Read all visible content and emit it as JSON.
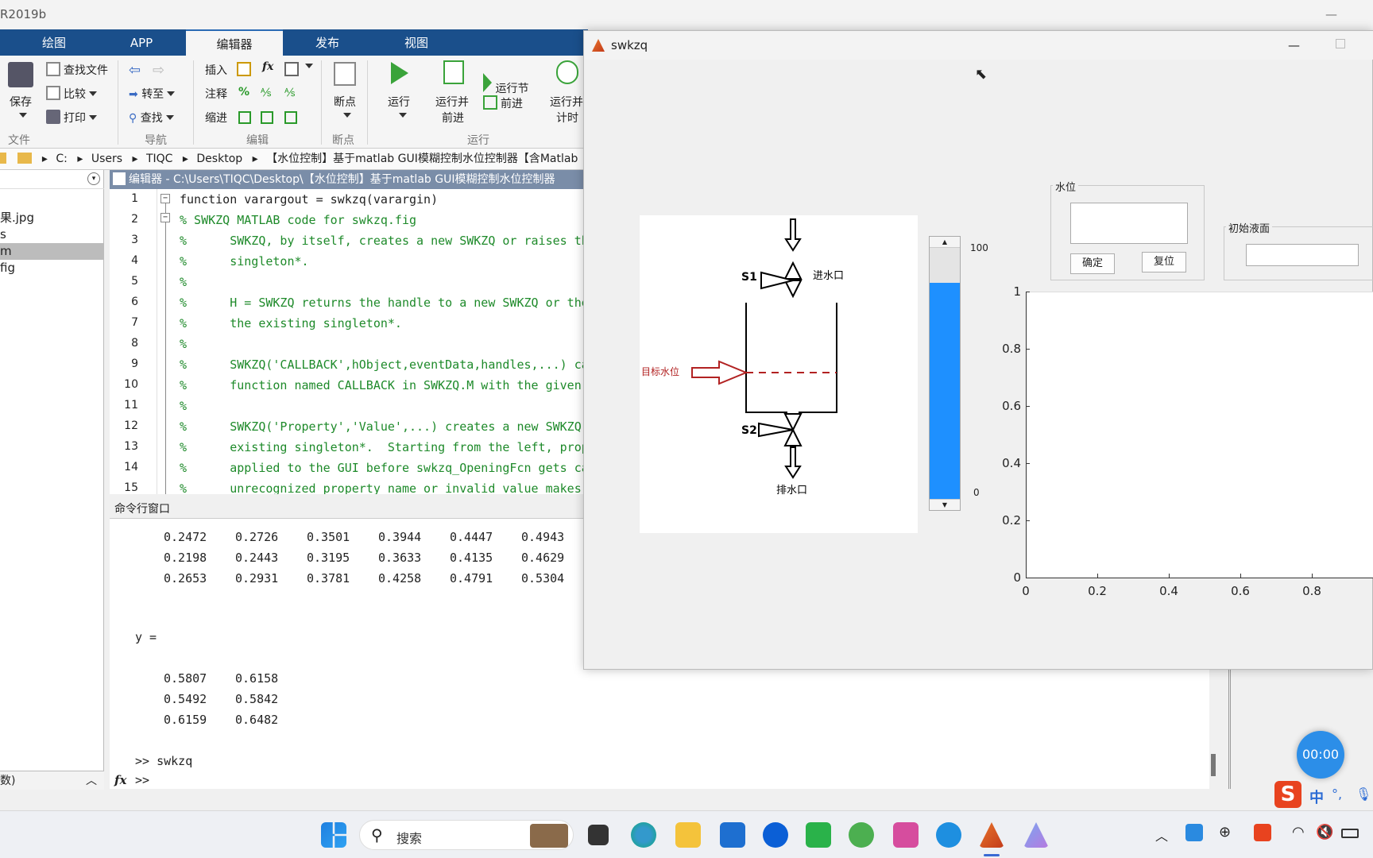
{
  "app": {
    "window_title": "R2019b",
    "tabs": [
      "绘图",
      "APP",
      "编辑器",
      "发布",
      "视图"
    ],
    "active_tab": "编辑器"
  },
  "toolstrip": {
    "file": {
      "save": "保存",
      "find_files": "查找文件",
      "compare": "比较",
      "print": "打印",
      "section": "文件"
    },
    "navigate": {
      "goto": "转至",
      "find": "查找",
      "section": "导航"
    },
    "edit": {
      "insert": "插入",
      "fx": "fx",
      "comment": "注释",
      "comment_sym": "%",
      "indent": "缩进",
      "section": "编辑"
    },
    "breakpoints": {
      "label": "断点",
      "section": "断点"
    },
    "run": {
      "run": "运行",
      "run_advance_1": "运行并",
      "run_advance_2": "前进",
      "run_section": "运行节",
      "advance": "前进",
      "run_time_1": "运行并",
      "run_time_2": "计时",
      "section": "运行"
    }
  },
  "address": {
    "crumbs": [
      "C:",
      "Users",
      "TIQC",
      "Desktop",
      "【水位控制】基于matlab GUI模糊控制水位控制器【含Matlab"
    ]
  },
  "file_browser": {
    "items": [
      "果.jpg",
      "s",
      "m",
      "fig"
    ],
    "selected_index": 2
  },
  "editor": {
    "header": "编辑器 - C:\\Users\\TIQC\\Desktop\\【水位控制】基于matlab GUI模糊控制水位控制器",
    "lines": [
      {
        "n": "1",
        "text": "function varargout = swkzq(varargin)"
      },
      {
        "n": "2",
        "text": "% SWKZQ MATLAB code for swkzq.fig"
      },
      {
        "n": "3",
        "text": "%      SWKZQ, by itself, creates a new SWKZQ or raises th"
      },
      {
        "n": "4",
        "text": "%      singleton*."
      },
      {
        "n": "5",
        "text": "%"
      },
      {
        "n": "6",
        "text": "%      H = SWKZQ returns the handle to a new SWKZQ or the"
      },
      {
        "n": "7",
        "text": "%      the existing singleton*."
      },
      {
        "n": "8",
        "text": "%"
      },
      {
        "n": "9",
        "text": "%      SWKZQ('CALLBACK',hObject,eventData,handles,...) ca"
      },
      {
        "n": "10",
        "text": "%      function named CALLBACK in SWKZQ.M with the given"
      },
      {
        "n": "11",
        "text": "%"
      },
      {
        "n": "12",
        "text": "%      SWKZQ('Property','Value',...) creates a new SWKZQ"
      },
      {
        "n": "13",
        "text": "%      existing singleton*.  Starting from the left, prop"
      },
      {
        "n": "14",
        "text": "%      applied to the GUI before swkzq_OpeningFcn gets ca"
      },
      {
        "n": "15",
        "text": "%      unrecognized property name or invalid value makes"
      }
    ]
  },
  "command_window": {
    "title": "命令行窗口",
    "matrix_rows": [
      [
        "0.2472",
        "0.2726",
        "0.3501",
        "0.3944",
        "0.4447",
        "0.4943"
      ],
      [
        "0.2198",
        "0.2443",
        "0.3195",
        "0.3633",
        "0.4135",
        "0.4629"
      ],
      [
        "0.2653",
        "0.2931",
        "0.3781",
        "0.4258",
        "0.4791",
        "0.5304"
      ]
    ],
    "var_label": "y =",
    "y_rows": [
      [
        "0.5807",
        "0.6158"
      ],
      [
        "0.5492",
        "0.5842"
      ],
      [
        "0.6159",
        "0.6482"
      ]
    ],
    "last_command": ">> swkzq",
    "prompt_fx": "fx",
    "prompt": ">>"
  },
  "workspace_footer": "数)",
  "figure": {
    "title": "swkzq",
    "diagram": {
      "s1": "S1",
      "inlet": "进水口",
      "target": "目标水位",
      "s2": "S2",
      "outlet": "排水口"
    },
    "slider": {
      "max_label": "100",
      "min_label": "0",
      "level": 0.86
    },
    "water_panel": {
      "title": "水位",
      "confirm": "确定",
      "reset": "复位"
    },
    "initial_panel": {
      "title": "初始液面"
    },
    "axes": {
      "y_ticks": [
        "1",
        "0.8",
        "0.6",
        "0.4",
        "0.2",
        "0"
      ],
      "x_ticks": [
        "0",
        "0.2",
        "0.4",
        "0.6",
        "0.8"
      ]
    }
  },
  "taskbar": {
    "search": "搜索",
    "ime": "中",
    "timer": "00:00"
  },
  "colors": {
    "accent": "#1a4f8b",
    "slider_fill": "#1e90ff",
    "comment": "#1e8a2a",
    "keyword": "#1a1aff",
    "diagram_red": "#b22222"
  }
}
